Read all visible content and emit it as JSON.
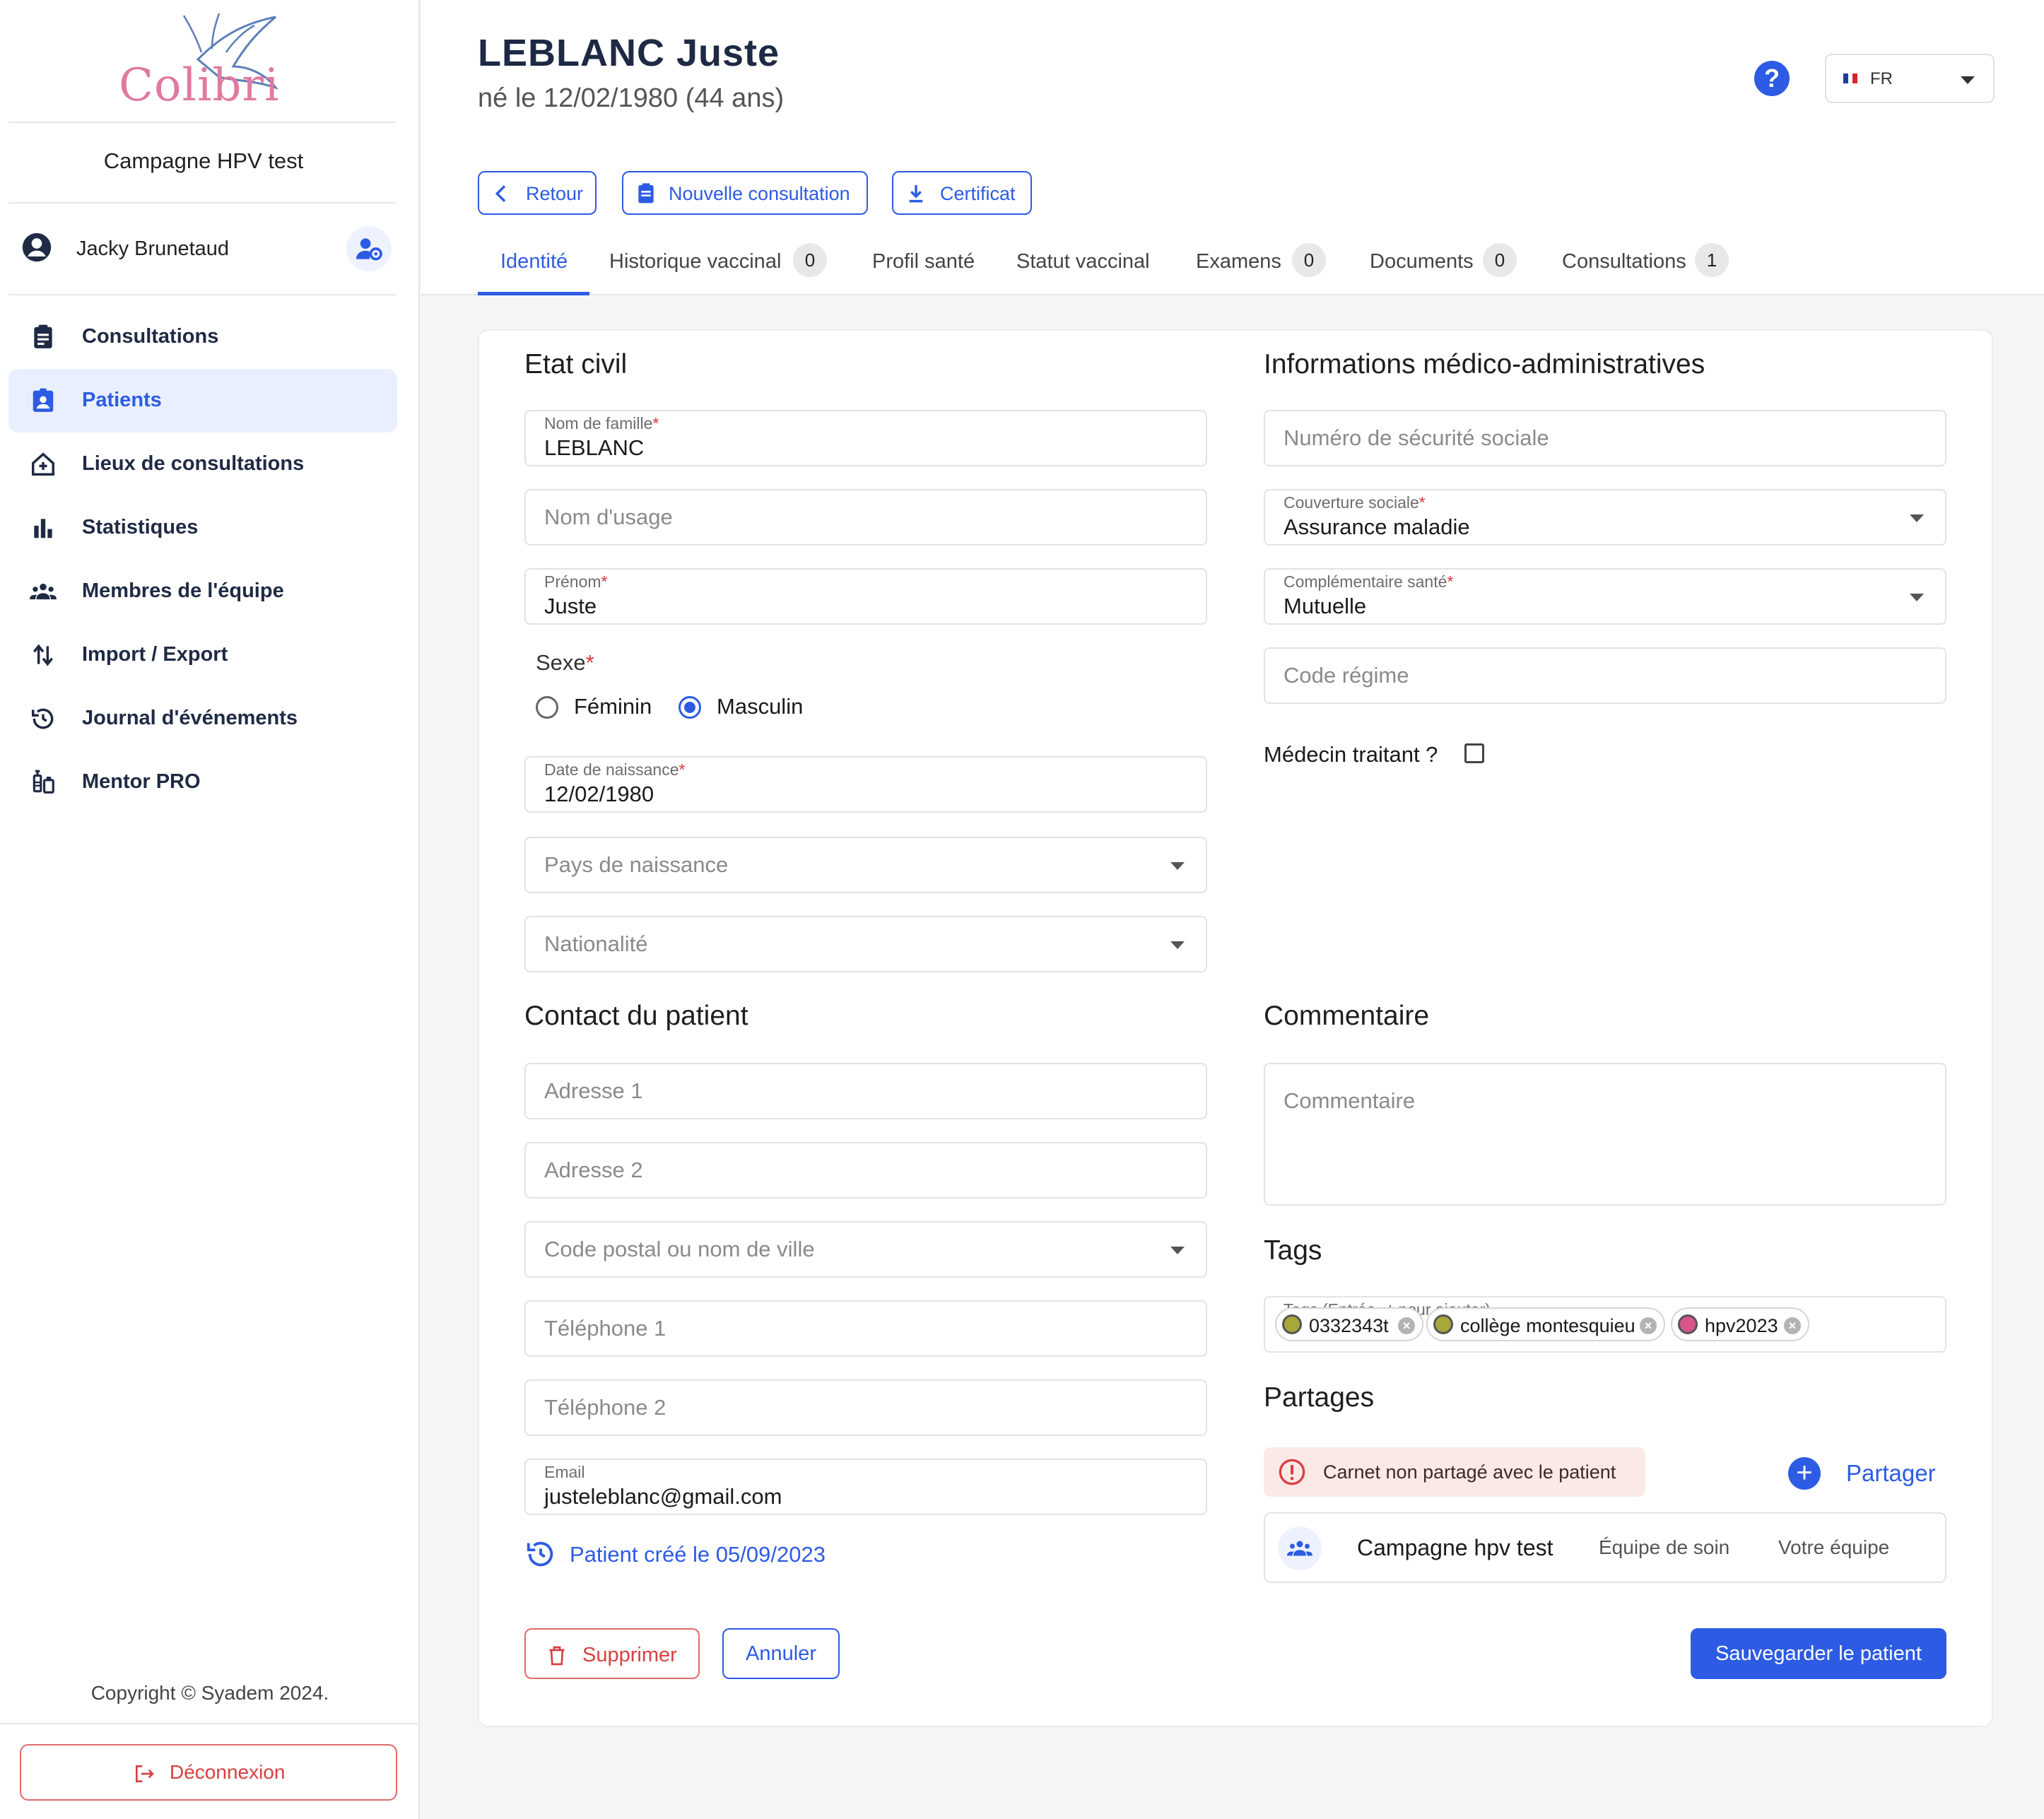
{
  "brand": {
    "name": "Colibri",
    "accent": "#2d5be3",
    "danger": "#d94040"
  },
  "sidebar": {
    "campaign": "Campagne HPV test",
    "user": {
      "name": "Jacky Brunetaud",
      "icon": "account-circle-icon",
      "settings_icon": "user-settings-icon"
    },
    "items": [
      {
        "label": "Consultations",
        "icon": "clipboard-icon",
        "active": false
      },
      {
        "label": "Patients",
        "icon": "patient-badge-icon",
        "active": true
      },
      {
        "label": "Lieux de consultations",
        "icon": "home-plus-icon",
        "active": false
      },
      {
        "label": "Statistiques",
        "icon": "bar-chart-icon",
        "active": false
      },
      {
        "label": "Membres de l'équipe",
        "icon": "group-icon",
        "active": false
      },
      {
        "label": "Import / Export",
        "icon": "swap-vertical-icon",
        "active": false
      },
      {
        "label": "Journal d'événements",
        "icon": "history-icon",
        "active": false
      },
      {
        "label": "Mentor PRO",
        "icon": "vaccine-icon",
        "active": false
      }
    ],
    "copyright": "Copyright © Syadem 2024.",
    "logout": "Déconnexion"
  },
  "header": {
    "patient_name": "LEBLANC Juste",
    "born": "né le 12/02/1980 (44 ans)",
    "lang": "FR",
    "buttons": {
      "back": "Retour",
      "new_consultation": "Nouvelle consultation",
      "certificate": "Certificat"
    },
    "tabs": [
      {
        "label": "Identité",
        "active": true
      },
      {
        "label": "Historique vaccinal",
        "badge": "0"
      },
      {
        "label": "Profil santé"
      },
      {
        "label": "Statut vaccinal"
      },
      {
        "label": "Examens",
        "badge": "0"
      },
      {
        "label": "Documents",
        "badge": "0"
      },
      {
        "label": "Consultations",
        "badge": "1"
      }
    ]
  },
  "etat_civil": {
    "title": "Etat civil",
    "nom_famille": {
      "label": "Nom de famille",
      "value": "LEBLANC"
    },
    "nom_usage": {
      "placeholder": "Nom d'usage"
    },
    "prenom": {
      "label": "Prénom",
      "value": "Juste"
    },
    "sexe": {
      "label": "Sexe",
      "options": [
        "Féminin",
        "Masculin"
      ],
      "selected": "Masculin"
    },
    "date_naissance": {
      "label": "Date de naissance",
      "value": "12/02/1980"
    },
    "pays_naissance": {
      "placeholder": "Pays de naissance"
    },
    "nationalite": {
      "placeholder": "Nationalité"
    }
  },
  "contact": {
    "title": "Contact du patient",
    "adresse1": "Adresse 1",
    "adresse2": "Adresse 2",
    "code_postal": "Code postal ou nom de ville",
    "tel1": "Téléphone 1",
    "tel2": "Téléphone 2",
    "email": {
      "label": "Email",
      "value": "justeleblanc@gmail.com"
    },
    "created": "Patient créé le 05/09/2023"
  },
  "medico": {
    "title": "Informations médico-administratives",
    "secu": {
      "placeholder": "Numéro de sécurité sociale"
    },
    "couverture": {
      "label": "Couverture sociale",
      "value": "Assurance maladie"
    },
    "complementaire": {
      "label": "Complémentaire santé",
      "value": "Mutuelle"
    },
    "code_regime": {
      "placeholder": "Code régime"
    },
    "medecin_traitant": {
      "label": "Médecin traitant ?",
      "checked": false
    }
  },
  "commentaire": {
    "title": "Commentaire",
    "placeholder": "Commentaire"
  },
  "tags": {
    "title": "Tags",
    "label": "Tags (Entrée ↵ pour ajouter)",
    "items": [
      {
        "label": "0332343t",
        "color": "#a7a83a"
      },
      {
        "label": "collège montesquieu",
        "color": "#a7a83a"
      },
      {
        "label": "hpv2023",
        "color": "#d6558a"
      }
    ]
  },
  "partages": {
    "title": "Partages",
    "alert": "Carnet non partagé avec le patient",
    "share_button": "Partager",
    "row": {
      "name": "Campagne hpv test",
      "type": "Équipe de soin",
      "owner": "Votre équipe"
    }
  },
  "actions": {
    "delete": "Supprimer",
    "cancel": "Annuler",
    "save": "Sauvegarder le patient"
  }
}
